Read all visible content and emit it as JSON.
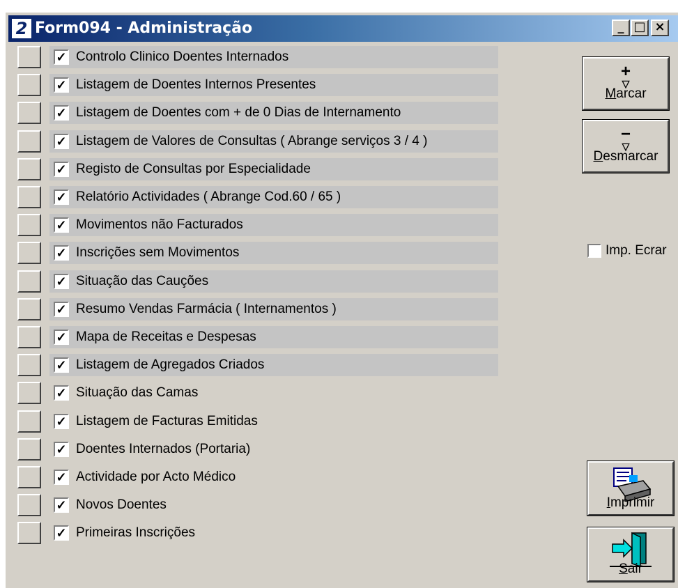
{
  "window": {
    "app_icon": "2",
    "title": "Form094 - Administração",
    "minimize": "_",
    "maximize": "□",
    "close": "×"
  },
  "reports": [
    {
      "label": "Controlo Clinico Doentes Internados",
      "checked": true,
      "highlighted": true
    },
    {
      "label": "Listagem de Doentes Internos Presentes",
      "checked": true,
      "highlighted": true
    },
    {
      "label": "Listagem de Doentes com + de 0 Dias de Internamento",
      "checked": true,
      "highlighted": true
    },
    {
      "label": "Listagem de Valores de Consultas ( Abrange serviços 3 / 4 )",
      "checked": true,
      "highlighted": true
    },
    {
      "label": "Registo de Consultas por Especialidade",
      "checked": true,
      "highlighted": true
    },
    {
      "label": "Relatório Actividades ( Abrange Cod.60 / 65 )",
      "checked": true,
      "highlighted": true
    },
    {
      "label": "Movimentos não Facturados",
      "checked": true,
      "highlighted": true
    },
    {
      "label": "Inscrições sem Movimentos",
      "checked": true,
      "highlighted": true
    },
    {
      "label": "Situação das Cauções",
      "checked": true,
      "highlighted": true
    },
    {
      "label": "Resumo Vendas Farmácia ( Internamentos )",
      "checked": true,
      "highlighted": true
    },
    {
      "label": "Mapa de Receitas e Despesas",
      "checked": true,
      "highlighted": true
    },
    {
      "label": "Listagem de Agregados Criados",
      "checked": true,
      "highlighted": true
    },
    {
      "label": "Situação das Camas",
      "checked": true,
      "highlighted": false
    },
    {
      "label": "Listagem de Facturas Emitidas",
      "checked": true,
      "highlighted": false
    },
    {
      "label": "Doentes Internados (Portaria)",
      "checked": true,
      "highlighted": false
    },
    {
      "label": "Actividade por Acto Médico",
      "checked": true,
      "highlighted": false
    },
    {
      "label": "Novos Doentes",
      "checked": true,
      "highlighted": false
    },
    {
      "label": "Primeiras Inscrições",
      "checked": true,
      "highlighted": false
    }
  ],
  "buttons": {
    "marcar": {
      "glyph": "+",
      "label_first": "M",
      "label_rest": "arcar"
    },
    "desmarcar": {
      "glyph": "−",
      "label_first": "D",
      "label_rest": "esmarcar"
    },
    "imprimir": {
      "label_first": "I",
      "label_rest": "mprimir",
      "icon": "printer-icon"
    },
    "sair": {
      "label_first": "S",
      "label_rest": "air",
      "icon": "exit-door-icon"
    }
  },
  "imp_ecrar": {
    "label": "Imp. Ecrar",
    "checked": false
  },
  "colors": {
    "title_start": "#0a246a",
    "title_end": "#a6caf0",
    "face": "#d4d0c8",
    "row_highlight": "#c4c4c4"
  }
}
